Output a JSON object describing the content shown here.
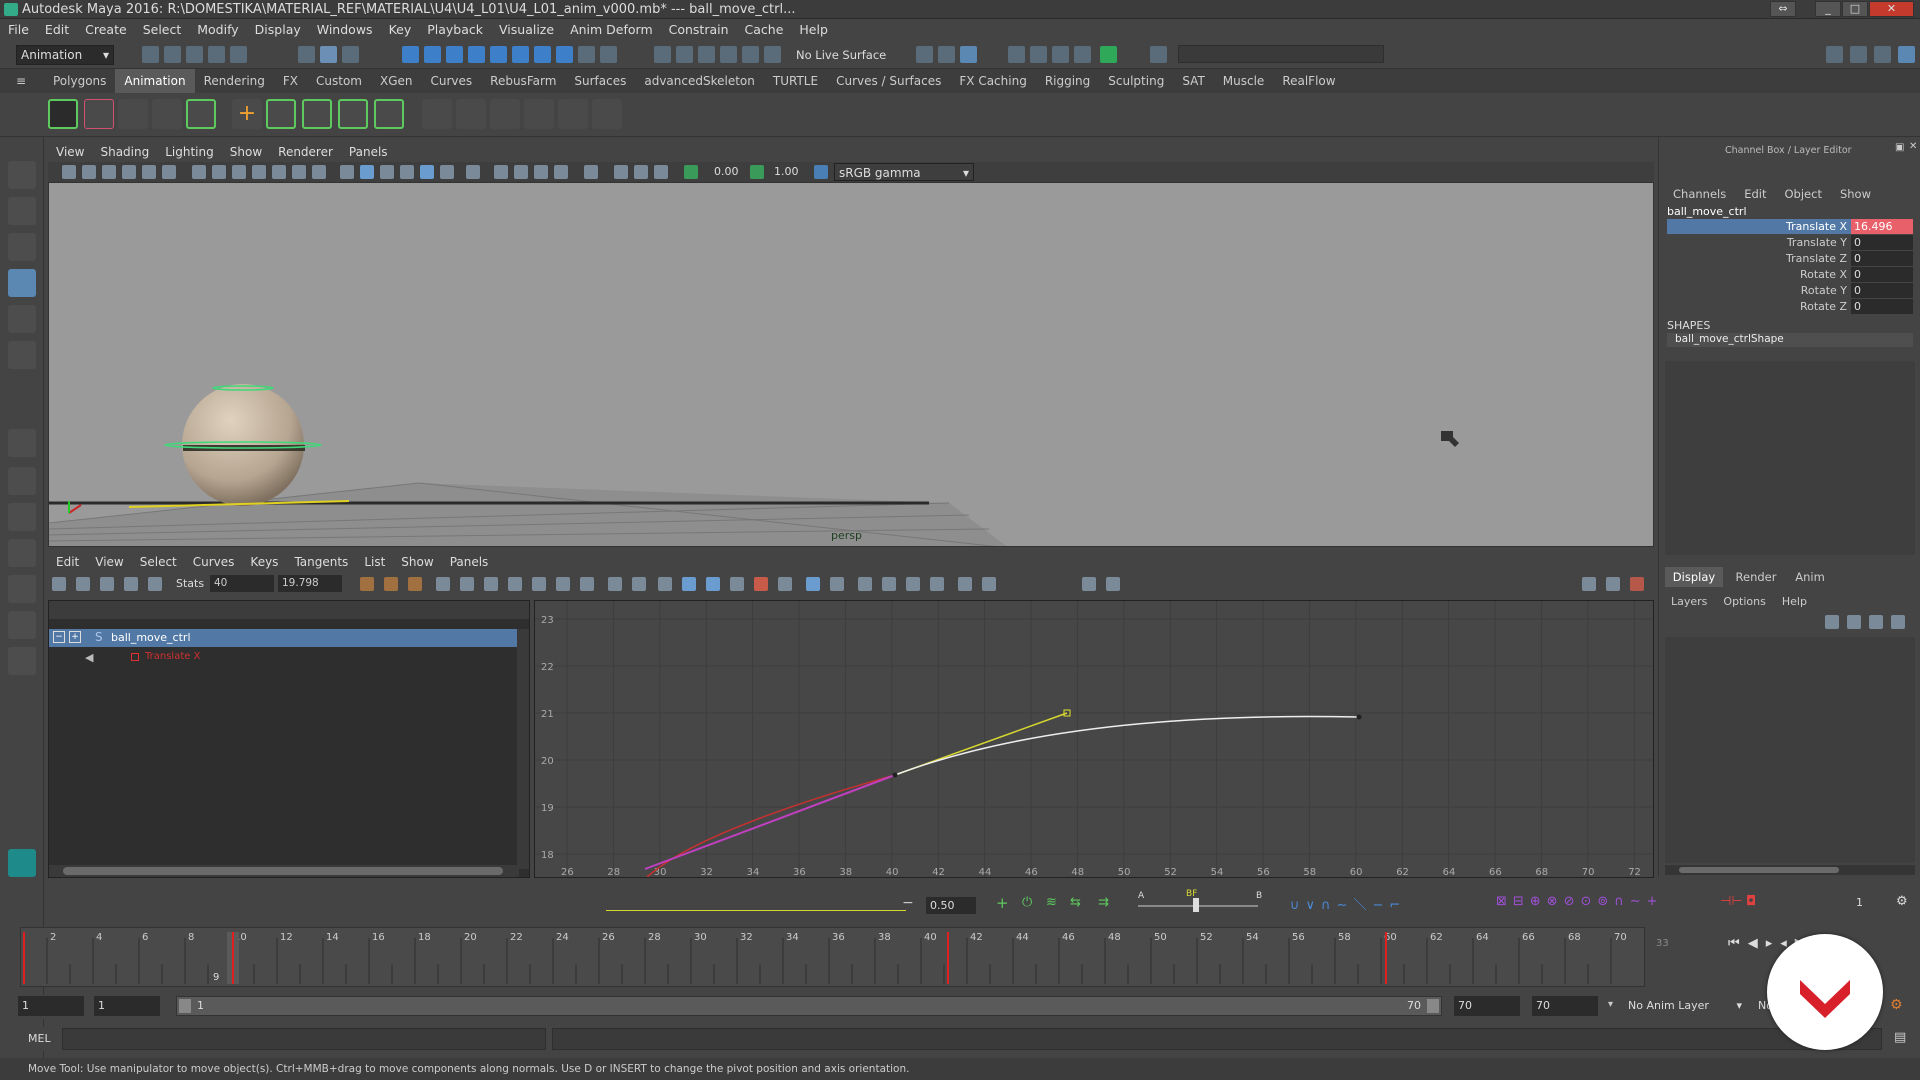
{
  "title": "Autodesk Maya 2016: R:\\DOMESTIKA\\MATERIAL_REF\\MATERIAL\\U4\\U4_L01\\U4_L01_anim_v000.mb* --- ball_move_ctrl...",
  "menus": [
    "File",
    "Edit",
    "Create",
    "Select",
    "Modify",
    "Display",
    "Windows",
    "Key",
    "Playback",
    "Visualize",
    "Anim Deform",
    "Constrain",
    "Cache",
    "Help"
  ],
  "mode_select": "Animation",
  "live_surface": "No Live Surface",
  "shelf_tabs": [
    "Polygons",
    "Animation",
    "Rendering",
    "FX",
    "Custom",
    "XGen",
    "Curves",
    "RebusFarm",
    "Surfaces",
    "advancedSkeleton",
    "TURTLE",
    "Curves / Surfaces",
    "FX Caching",
    "Rigging",
    "Sculpting",
    "SAT",
    "Muscle",
    "RealFlow"
  ],
  "viewport": {
    "menus": [
      "View",
      "Shading",
      "Lighting",
      "Show",
      "Renderer",
      "Panels"
    ],
    "near": "0.00",
    "far": "1.00",
    "color_space": "sRGB gamma",
    "camera": "persp"
  },
  "graph_editor": {
    "menus": [
      "Edit",
      "View",
      "Select",
      "Curves",
      "Keys",
      "Tangents",
      "List",
      "Show",
      "Panels"
    ],
    "stats_label": "Stats",
    "stats_frame": "40",
    "stats_value": "19.798",
    "outliner_node": "ball_move_ctrl",
    "outliner_attr": "Translate X",
    "y_ticks": [
      "23",
      "22",
      "21",
      "20",
      "19",
      "18"
    ],
    "x_ticks": [
      "26",
      "28",
      "30",
      "32",
      "34",
      "36",
      "38",
      "40",
      "42",
      "44",
      "46",
      "48",
      "50",
      "52",
      "54",
      "56",
      "58",
      "60",
      "62",
      "64",
      "66",
      "68",
      "70",
      "72"
    ]
  },
  "channel_box": {
    "title": "Channel Box / Layer Editor",
    "menus": [
      "Channels",
      "Edit",
      "Object",
      "Show"
    ],
    "node": "ball_move_ctrl",
    "channels": [
      {
        "name": "Translate X",
        "value": "16.496"
      },
      {
        "name": "Translate Y",
        "value": "0"
      },
      {
        "name": "Translate Z",
        "value": "0"
      },
      {
        "name": "Rotate X",
        "value": "0"
      },
      {
        "name": "Rotate Y",
        "value": "0"
      },
      {
        "name": "Rotate Z",
        "value": "0"
      }
    ],
    "shapes_label": "SHAPES",
    "shape_name": "ball_move_ctrlShape"
  },
  "layer_editor": {
    "tabs": [
      "Display",
      "Render",
      "Anim"
    ],
    "menus": [
      "Layers",
      "Options",
      "Help"
    ]
  },
  "ctrl_bar": {
    "weight": "0.50",
    "a_label": "A",
    "b_label": "B",
    "bf_label": "BF",
    "page": "1"
  },
  "timeline": {
    "ticks": [
      "2",
      "4",
      "6",
      "8",
      "10",
      "12",
      "14",
      "16",
      "18",
      "20",
      "22",
      "24",
      "26",
      "28",
      "30",
      "32",
      "34",
      "36",
      "38",
      "40",
      "42",
      "44",
      "46",
      "48",
      "50",
      "52",
      "54",
      "56",
      "58",
      "60",
      "62",
      "64",
      "66",
      "68",
      "70"
    ],
    "current_frame": "9",
    "end_label": "33"
  },
  "range": {
    "start": "1",
    "anim_start": "1",
    "slider_start": "1",
    "slider_end": "70",
    "anim_end": "70",
    "end": "70",
    "anim_layer": "No Anim Layer",
    "char_set": "No"
  },
  "cmd_label": "MEL",
  "help_text": "Move Tool: Use manipulator to move object(s). Ctrl+MMB+drag to move components along normals. Use D or INSERT to change the pivot position and axis orientation."
}
